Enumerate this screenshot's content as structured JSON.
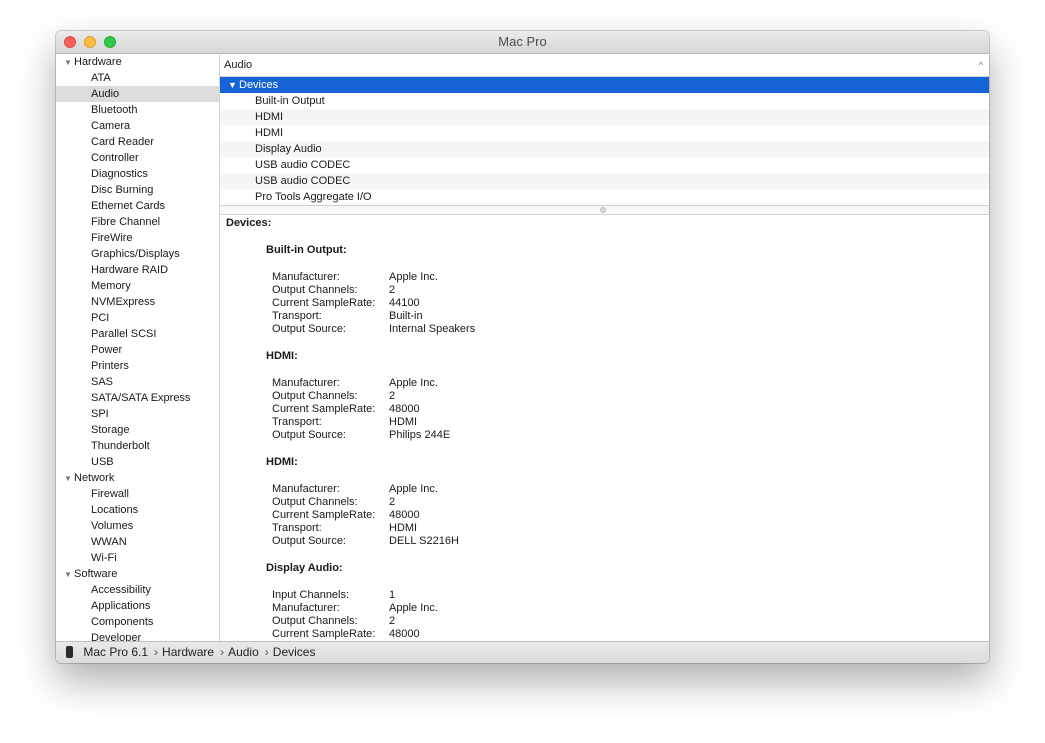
{
  "window": {
    "title": "Mac Pro"
  },
  "sidebar": {
    "groups": [
      {
        "label": "Hardware",
        "items": [
          "ATA",
          "Audio",
          "Bluetooth",
          "Camera",
          "Card Reader",
          "Controller",
          "Diagnostics",
          "Disc Burning",
          "Ethernet Cards",
          "Fibre Channel",
          "FireWire",
          "Graphics/Displays",
          "Hardware RAID",
          "Memory",
          "NVMExpress",
          "PCI",
          "Parallel SCSI",
          "Power",
          "Printers",
          "SAS",
          "SATA/SATA Express",
          "SPI",
          "Storage",
          "Thunderbolt",
          "USB"
        ]
      },
      {
        "label": "Network",
        "items": [
          "Firewall",
          "Locations",
          "Volumes",
          "WWAN",
          "Wi-Fi"
        ]
      },
      {
        "label": "Software",
        "items": [
          "Accessibility",
          "Applications",
          "Components",
          "Developer"
        ]
      }
    ],
    "selected": "Audio"
  },
  "list": {
    "header": "Audio",
    "category": "Devices",
    "items": [
      "Built-in Output",
      "HDMI",
      "HDMI",
      "Display Audio",
      "USB audio CODEC",
      "USB audio CODEC",
      "Pro Tools Aggregate I/O"
    ]
  },
  "detail": {
    "heading": "Devices:",
    "devices": [
      {
        "title": "Built-in Output:",
        "props": [
          [
            "Manufacturer:",
            "Apple Inc."
          ],
          [
            "Output Channels:",
            "2"
          ],
          [
            "Current SampleRate:",
            "44100"
          ],
          [
            "Transport:",
            "Built-in"
          ],
          [
            "Output Source:",
            "Internal Speakers"
          ]
        ]
      },
      {
        "title": "HDMI:",
        "props": [
          [
            "Manufacturer:",
            "Apple Inc."
          ],
          [
            "Output Channels:",
            "2"
          ],
          [
            "Current SampleRate:",
            "48000"
          ],
          [
            "Transport:",
            "HDMI"
          ],
          [
            "Output Source:",
            "Philips 244E"
          ]
        ]
      },
      {
        "title": "HDMI:",
        "props": [
          [
            "Manufacturer:",
            "Apple Inc."
          ],
          [
            "Output Channels:",
            "2"
          ],
          [
            "Current SampleRate:",
            "48000"
          ],
          [
            "Transport:",
            "HDMI"
          ],
          [
            "Output Source:",
            "DELL S2216H"
          ]
        ]
      },
      {
        "title": "Display Audio:",
        "props": [
          [
            "Input Channels:",
            "1"
          ],
          [
            "Manufacturer:",
            "Apple Inc."
          ],
          [
            "Output Channels:",
            "2"
          ],
          [
            "Current SampleRate:",
            "48000"
          ]
        ]
      }
    ]
  },
  "statusbar": {
    "path": [
      "Mac Pro 6.1",
      "Hardware",
      "Audio",
      "Devices"
    ],
    "separator": "›"
  },
  "icons": {
    "disclosure": "▼",
    "sort": "^"
  },
  "colors": {
    "selection": "#1764d6",
    "sidebar_selection": "#dcdcdc"
  }
}
